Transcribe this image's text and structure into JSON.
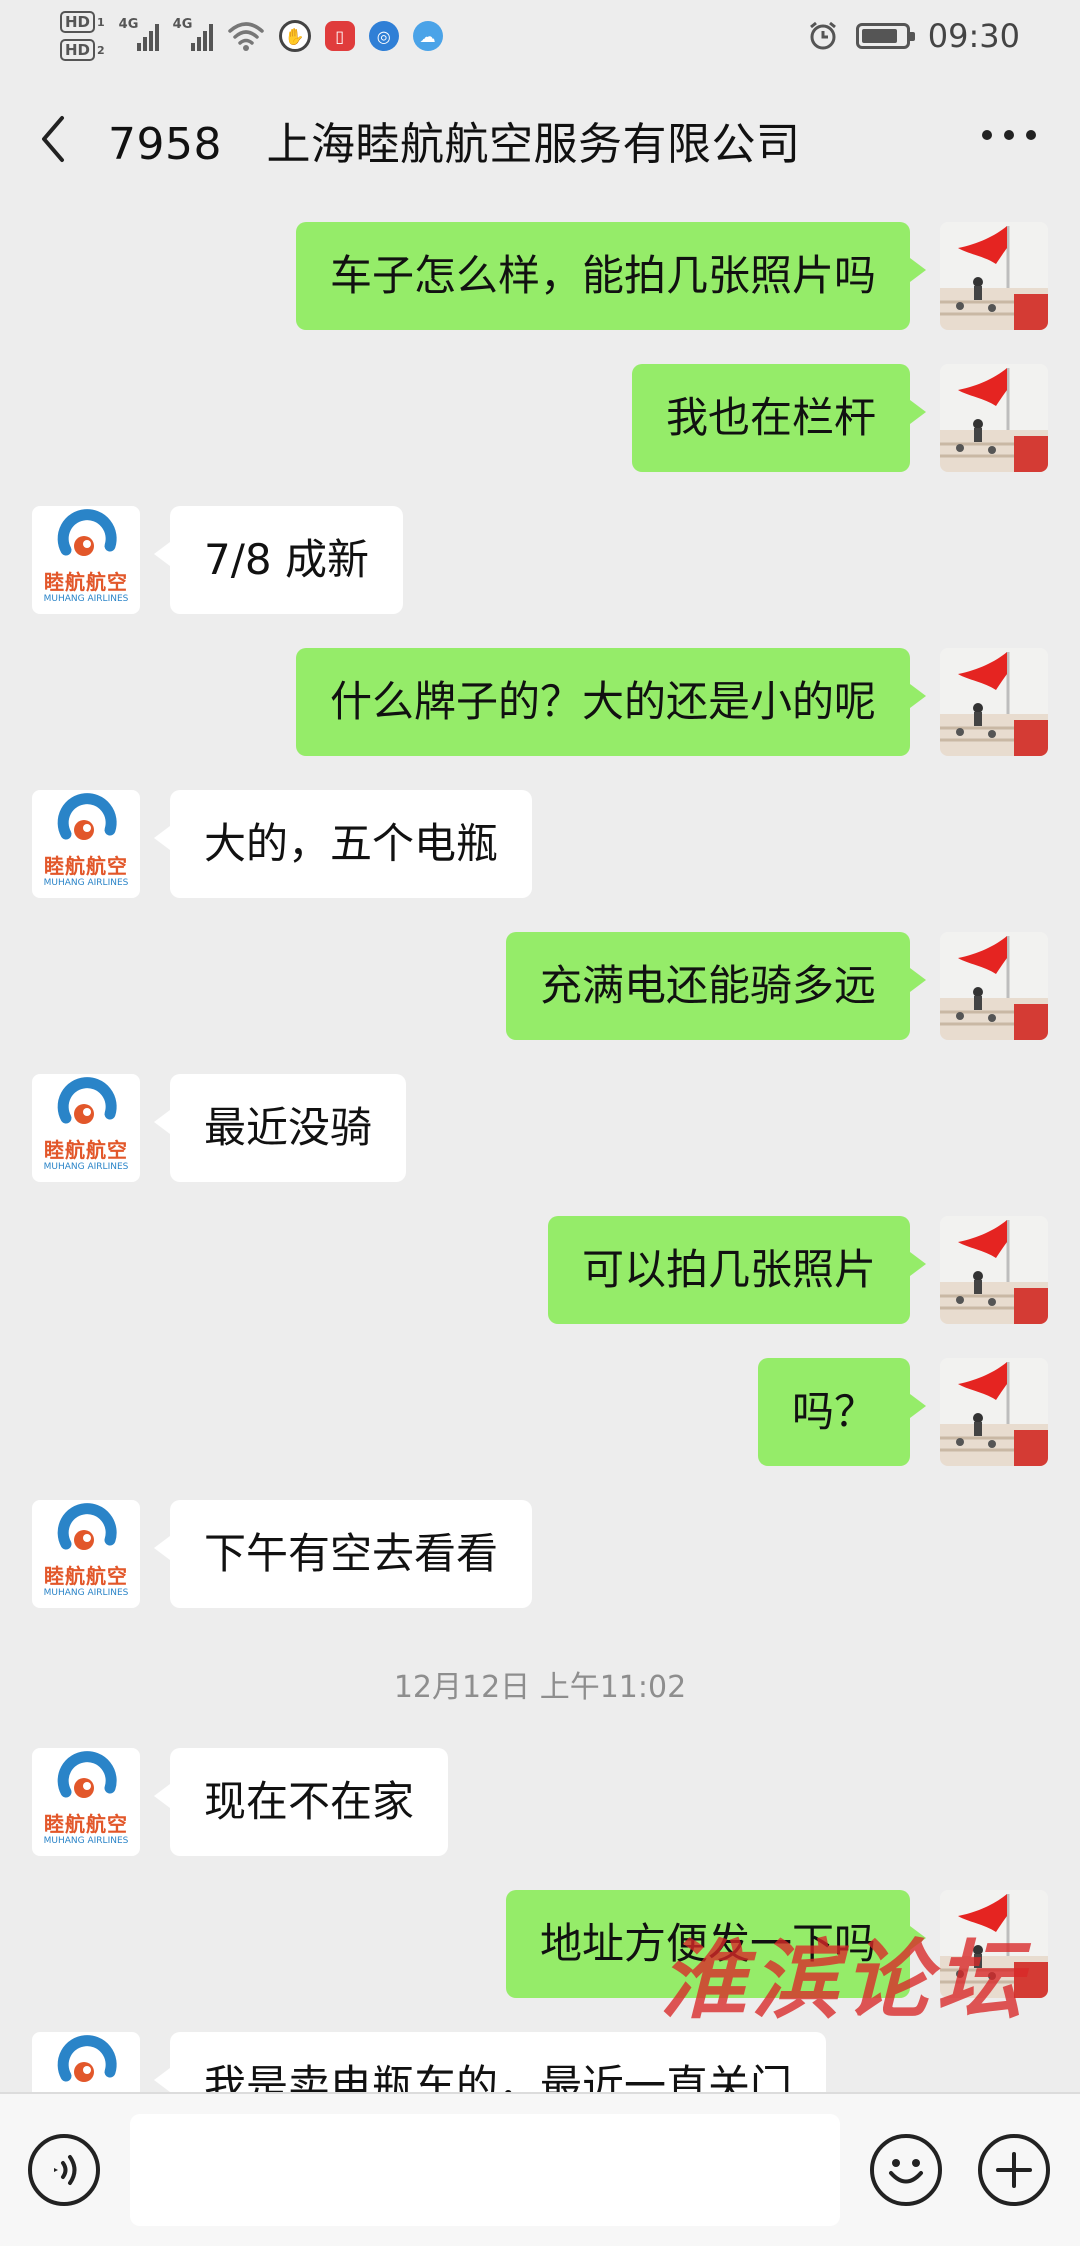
{
  "status_bar": {
    "hd1": "HD",
    "hd1_sub": "1",
    "hd2": "HD",
    "hd2_sub": "2",
    "network1": "4G",
    "network2": "4G",
    "time": "09:30",
    "battery_level": 0.85,
    "app_icons": [
      "hand-icon",
      "red-book-icon",
      "browser-icon",
      "cloud-icon"
    ]
  },
  "header": {
    "title": "7958　上海睦航航空服务有限公司",
    "back_icon": "back-arrow-icon",
    "more_icon": "more-icon"
  },
  "chat": {
    "messages": [
      {
        "side": "out",
        "text": "车子怎么样，能拍几张照片吗"
      },
      {
        "side": "out",
        "text": "我也在栏杆"
      },
      {
        "side": "in",
        "text": "7/8 成新"
      },
      {
        "side": "out",
        "text": "什么牌子的？大的还是小的呢"
      },
      {
        "side": "in",
        "text": "大的，五个电瓶"
      },
      {
        "side": "out",
        "text": "充满电还能骑多远"
      },
      {
        "side": "in",
        "text": "最近没骑"
      },
      {
        "side": "out",
        "text": "可以拍几张照片"
      },
      {
        "side": "out",
        "text": "吗？"
      },
      {
        "side": "in",
        "text": "下午有空去看看"
      },
      {
        "side": "in",
        "text": "现在不在家"
      },
      {
        "side": "out",
        "text": "地址方便发一下吗"
      },
      {
        "side": "in",
        "text": "我是卖电瓶车的，最近一直关门"
      }
    ],
    "timestamp": "12月12日 上午11:02",
    "contact_logo": {
      "cn": "睦航航空",
      "en": "MUHANG AIRLINES"
    }
  },
  "watermark": "淮滨论坛",
  "input_bar": {
    "voice_icon": "voice-icon",
    "emoji_icon": "emoji-icon",
    "plus_icon": "plus-icon",
    "input_value": ""
  },
  "colors": {
    "outgoing_bubble": "#95ec69",
    "incoming_bubble": "#ffffff",
    "background": "#ededed",
    "logo_orange": "#e2572a",
    "logo_blue": "#2a84c8"
  }
}
